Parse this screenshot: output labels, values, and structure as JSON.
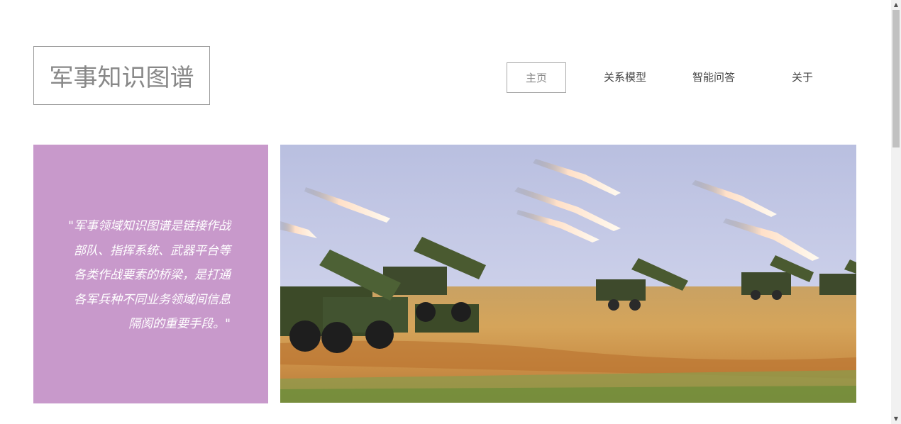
{
  "header": {
    "logo_text": "军事知识图谱"
  },
  "nav": {
    "items": [
      {
        "label": "主页",
        "active": true
      },
      {
        "label": "关系模型",
        "active": false
      },
      {
        "label": "智能问答",
        "active": false
      },
      {
        "label": "关于",
        "active": false
      }
    ]
  },
  "hero": {
    "quote_lines": [
      "\"军事领域知识图谱是链接作战",
      "部队、指挥系统、武器平台等",
      "各类作战要素的桥梁，是打通",
      "各军兵种不同业务领域间信息",
      "隔阂的重要手段。\""
    ],
    "quote_bg_color": "#c899cb",
    "image_subject": "multiple-rocket-launcher-vehicles-firing"
  },
  "scrollbar": {
    "up_icon": "scroll-up-arrow-icon",
    "down_icon": "scroll-down-arrow-icon"
  }
}
